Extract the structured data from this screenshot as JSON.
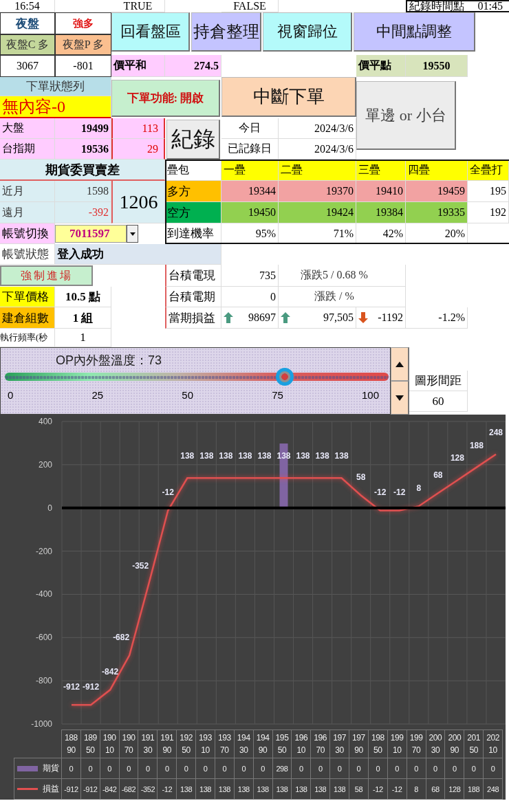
{
  "top_row": {
    "time": "16:54",
    "flag_1": "TRUE",
    "flag_2": "FALSE",
    "record_time": {
      "label": "紀錄時間點",
      "value": "01:45"
    }
  },
  "night_session": {
    "title": "夜盤",
    "bias": "強多",
    "call": "夜盤C 多",
    "put": "夜盤P 多",
    "call_value": "3067",
    "put_value": "-801"
  },
  "buttons": [
    {
      "label": "回看盤區",
      "color": "#b4fafa"
    },
    {
      "label": "持倉整理",
      "color": "#c4c4ff"
    },
    {
      "label": "視窗歸位",
      "color": "#b4fafa"
    },
    {
      "label": "中間點調整",
      "color": "#c4c4ff"
    }
  ],
  "atm_sum": {
    "label": "價平和",
    "value": "274.5"
  },
  "atm_point": {
    "label": "價平點",
    "value": "19550"
  },
  "order_status": {
    "title": "下單狀態列",
    "message": "無內容-0"
  },
  "order_function_button": "下單功能: 開啟",
  "stop_order_button": "中斷下單",
  "side_button": "單邊 or 小台",
  "record_button": "紀錄",
  "quotes": [
    {
      "label": "大盤",
      "value": "19499",
      "diff": "113"
    },
    {
      "label": "台指期",
      "value": "19536",
      "diff": "29"
    }
  ],
  "dates": [
    {
      "label": "今日",
      "value": "2024/3/6"
    },
    {
      "label": "已記錄日",
      "value": "2024/3/6"
    }
  ],
  "bid_ask": {
    "title": "期貨委買賣差",
    "rows": [
      {
        "label": "近月",
        "value": "1598",
        "negative": false
      },
      {
        "label": "遠月",
        "value": "-392",
        "negative": true
      }
    ],
    "total": "1206"
  },
  "account": {
    "switch_label": "帳號切換",
    "account_id": "7011597",
    "status_label": "帳號狀態",
    "status": "登入成功"
  },
  "force_entry_button": "強制進場",
  "settings": [
    {
      "label": "下單價格",
      "value": "10.5 點",
      "color": "#ffff00"
    },
    {
      "label": "建倉組數",
      "value": "1 組",
      "color": "#ffc000"
    },
    {
      "label": "執行頻率(秒",
      "value": "1"
    }
  ],
  "layers": {
    "corner": "疊包",
    "headers": [
      "一疊",
      "二疊",
      "三疊",
      "四疊",
      "全疊打"
    ],
    "rows": [
      {
        "kind": "long",
        "label": "多方",
        "values": [
          "19344",
          "19370",
          "19410",
          "19459",
          "195"
        ]
      },
      {
        "kind": "short",
        "label": "空方",
        "values": [
          "19450",
          "19424",
          "19384",
          "19335",
          "192"
        ]
      },
      {
        "kind": "probability",
        "label": "到達機率",
        "values": [
          "95%",
          "71%",
          "42%",
          "20%"
        ]
      }
    ]
  },
  "tsmc": [
    {
      "label": "台積電現",
      "value": "735",
      "change": "漲跌5 / 0.68 %"
    },
    {
      "label": "台積電期",
      "value": "0",
      "change": "漲跌 /  %"
    }
  ],
  "pnl": {
    "label": "當期損益",
    "items": [
      {
        "kind": "up",
        "value": "98697"
      },
      {
        "kind": "up",
        "value": "97,505"
      },
      {
        "kind": "down",
        "value": "-1192"
      }
    ],
    "percent": "-1.2%"
  },
  "temperature": {
    "title": "OP內外盤溫度：73",
    "level": 0.73,
    "ticks": [
      "0",
      "25",
      "50",
      "75",
      "100"
    ]
  },
  "spacing": {
    "label": "圖形間距",
    "value": "60"
  },
  "chart": {
    "data_table": [
      [
        "0",
        "0",
        "0",
        "0",
        "0",
        "0",
        "0",
        "0",
        "0",
        "0",
        "0",
        "298",
        "0",
        "0",
        "0",
        "0",
        "0",
        "0",
        "0",
        "0",
        "0",
        "0",
        "0"
      ],
      [
        "-912",
        "-912",
        "-842",
        "-682",
        "-352",
        "-12",
        "138",
        "138",
        "138",
        "138",
        "138",
        "138",
        "138",
        "138",
        "138",
        "58",
        "-12",
        "-12",
        "8",
        "68",
        "128",
        "188",
        "248"
      ]
    ],
    "chart_data": {
      "type": "bar",
      "categories": [
        "18890",
        "18950",
        "19010",
        "19070",
        "19130",
        "19190",
        "19250",
        "19310",
        "19370",
        "19430",
        "19490",
        "19550",
        "19610",
        "19670",
        "19730",
        "19790",
        "19850",
        "19910",
        "19970",
        "20030",
        "20090",
        "20150",
        "20210"
      ],
      "series": [
        {
          "name": "期貨",
          "color": "#8064a2",
          "values": [
            0,
            0,
            0,
            0,
            0,
            0,
            0,
            0,
            0,
            0,
            0,
            298,
            0,
            0,
            0,
            0,
            0,
            0,
            0,
            0,
            0,
            0,
            0
          ]
        },
        {
          "name": "損益",
          "type": "line",
          "color": "#e05050",
          "values": [
            -912,
            -912,
            -842,
            -682,
            -352,
            -12,
            138,
            138,
            138,
            138,
            138,
            138,
            138,
            138,
            138,
            58,
            -12,
            -12,
            8,
            68,
            128,
            188,
            248
          ]
        }
      ],
      "ylim": [
        -1000,
        400
      ],
      "yticks": [
        -1000,
        -800,
        -600,
        -400,
        -200,
        0,
        200,
        400
      ],
      "grid": true,
      "legend": "bottom",
      "value_labels": [
        "-912",
        "-912",
        "-842",
        "-682",
        "-352",
        "-12",
        "138",
        "138",
        "138",
        "138",
        "138",
        "138",
        "138",
        "138",
        "138",
        "58",
        "-12",
        "-12",
        "8",
        "68",
        "128",
        "188",
        "248"
      ]
    }
  }
}
